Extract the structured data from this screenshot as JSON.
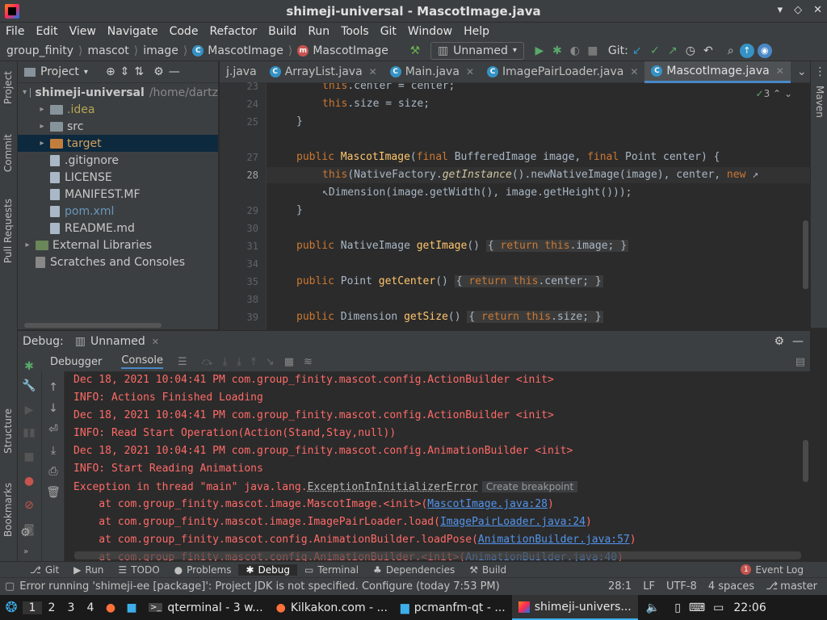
{
  "window": {
    "title": "shimeji-universal - MascotImage.java"
  },
  "menu": [
    "File",
    "Edit",
    "View",
    "Navigate",
    "Code",
    "Refactor",
    "Build",
    "Run",
    "Tools",
    "Git",
    "Window",
    "Help"
  ],
  "nav": {
    "crumbs": [
      "group_finity",
      "mascot",
      "image",
      "MascotImage",
      "MascotImage"
    ],
    "run_config": "Unnamed",
    "git_label": "Git:"
  },
  "project": {
    "header": "Project",
    "items": [
      {
        "label": "shimeji-universal",
        "hint": "/home/dartz",
        "type": "module",
        "indent": 0,
        "arrow": "▾"
      },
      {
        "label": ".idea",
        "type": "folder",
        "indent": 1,
        "arrow": "▸",
        "color": "#b5a553"
      },
      {
        "label": "src",
        "type": "folder",
        "indent": 1,
        "arrow": "▸"
      },
      {
        "label": "target",
        "type": "folder-orange",
        "indent": 1,
        "arrow": "▸",
        "color": "#d2a05c"
      },
      {
        "label": ".gitignore",
        "type": "file",
        "indent": 1,
        "arrow": ""
      },
      {
        "label": "LICENSE",
        "type": "file",
        "indent": 1,
        "arrow": ""
      },
      {
        "label": "MANIFEST.MF",
        "type": "file",
        "indent": 1,
        "arrow": ""
      },
      {
        "label": "pom.xml",
        "type": "file",
        "indent": 1,
        "arrow": "",
        "color": "#6897bb"
      },
      {
        "label": "README.md",
        "type": "file",
        "indent": 1,
        "arrow": ""
      },
      {
        "label": "External Libraries",
        "type": "lib",
        "indent": 0,
        "arrow": "▸"
      },
      {
        "label": "Scratches and Consoles",
        "type": "scratch",
        "indent": 0,
        "arrow": ""
      }
    ]
  },
  "tabs": [
    {
      "label": "j.java"
    },
    {
      "label": "ArrayList.java"
    },
    {
      "label": "Main.java"
    },
    {
      "label": "ImagePairLoader.java"
    },
    {
      "label": "MascotImage.java",
      "active": true
    }
  ],
  "editor": {
    "inspection_count": "3",
    "line_numbers": [
      "23",
      "24",
      "25",
      "",
      "27",
      "28",
      "",
      "29",
      "30",
      "31",
      "34",
      "35",
      "38",
      "39"
    ]
  },
  "debug": {
    "label": "Debug:",
    "session": "Unnamed",
    "tabs": [
      "Debugger",
      "Console"
    ]
  },
  "console": {
    "lines": [
      "Dec 18, 2021 10:04:41 PM com.group_finity.mascot.config.ActionBuilder <init>",
      "INFO: Actions Finished Loading",
      "Dec 18, 2021 10:04:41 PM com.group_finity.mascot.config.ActionBuilder <init>",
      "INFO: Read Start Operation(Action(Stand,Stay,null))",
      "Dec 18, 2021 10:04:41 PM com.group_finity.mascot.config.AnimationBuilder <init>",
      "INFO: Start Reading Animations"
    ],
    "exception_prefix": "Exception in thread \"main\" java.lang.",
    "exception_name": "ExceptionInInitializerError",
    "tooltip": "Create breakpoint",
    "stack": [
      {
        "text": "    at com.group_finity.mascot.image.MascotImage.<init>(",
        "link": "MascotImage.java:28",
        "tail": ")"
      },
      {
        "text": "    at com.group_finity.mascot.image.ImagePairLoader.load(",
        "link": "ImagePairLoader.java:24",
        "tail": ")"
      },
      {
        "text": "    at com.group_finity.mascot.config.AnimationBuilder.loadPose(",
        "link": "AnimationBuilder.java:57",
        "tail": ")"
      },
      {
        "text": "    at com.group_finity.mascot.config.AnimationBuilder.<init>(",
        "link": "AnimationBuilder.java:40",
        "tail": ")"
      }
    ]
  },
  "toolwindows": [
    {
      "label": "Git",
      "icon": "⎇"
    },
    {
      "label": "Run",
      "icon": "▶"
    },
    {
      "label": "TODO",
      "icon": "☰"
    },
    {
      "label": "Problems",
      "icon": "●"
    },
    {
      "label": "Debug",
      "icon": "✱",
      "active": true
    },
    {
      "label": "Terminal",
      "icon": "▭"
    },
    {
      "label": "Dependencies",
      "icon": "♣"
    },
    {
      "label": "Build",
      "icon": "⚒"
    }
  ],
  "event_log": {
    "count": "1",
    "label": "Event Log"
  },
  "status": {
    "message": "Error running 'shimeji-ee [package]': Project JDK is not specified. Configure (today 7:53 PM)",
    "position": "28:1",
    "line_sep": "LF",
    "encoding": "UTF-8",
    "indent": "4 spaces",
    "branch": "master"
  },
  "taskbar": {
    "workspaces": [
      "1",
      "2",
      "3",
      "4"
    ],
    "tasks": [
      {
        "label": "qterminal - 3 w..."
      },
      {
        "label": "Kilkakon.com - ..."
      },
      {
        "label": "pcmanfm-qt - ..."
      },
      {
        "label": "shimeji-univers...",
        "active": true
      }
    ],
    "clock": "22:06"
  },
  "side_tabs": {
    "left": [
      "Project",
      "Commit",
      "Pull Requests",
      "Structure",
      "Bookmarks"
    ],
    "right": [
      "Maven"
    ]
  }
}
